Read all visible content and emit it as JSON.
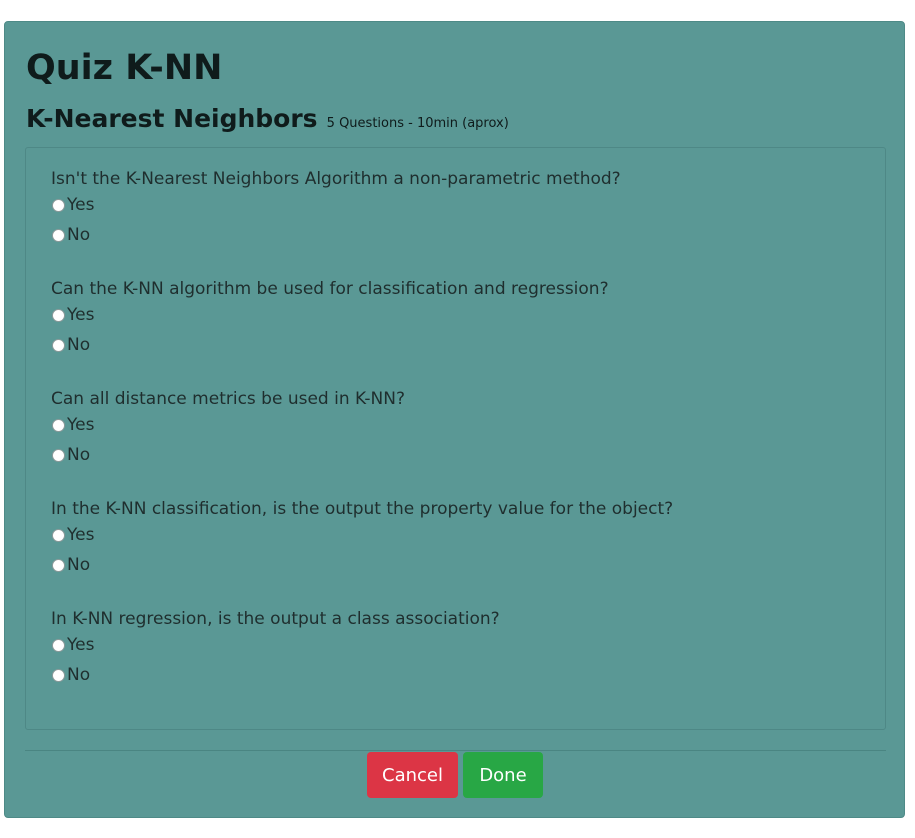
{
  "quiz": {
    "title": "Quiz K-NN",
    "subtitle": "K-Nearest Neighbors",
    "info": "5 Questions - 10min (aprox)"
  },
  "questions": [
    {
      "text": "Isn't the K-Nearest Neighbors Algorithm a non-parametric method?",
      "options": [
        "Yes",
        "No"
      ]
    },
    {
      "text": "Can the K-NN algorithm be used for classification and regression?",
      "options": [
        "Yes",
        "No"
      ]
    },
    {
      "text": "Can all distance metrics be used in K-NN?",
      "options": [
        "Yes",
        "No"
      ]
    },
    {
      "text": "In the K-NN classification, is the output the property value for the object?",
      "options": [
        "Yes",
        "No"
      ]
    },
    {
      "text": "In K-NN regression, is the output a class association?",
      "options": [
        "Yes",
        "No"
      ]
    }
  ],
  "actions": {
    "cancel_label": "Cancel",
    "done_label": "Done"
  },
  "colors": {
    "panel": "#5a9895",
    "cancel": "#dc3545",
    "done": "#28a745"
  }
}
